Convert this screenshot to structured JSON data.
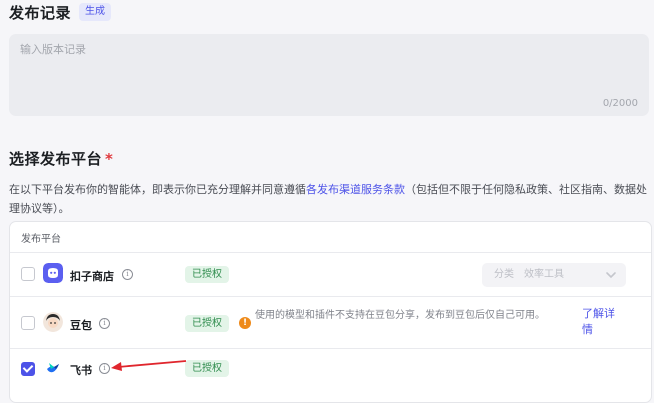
{
  "release_notes": {
    "title": "发布记录",
    "generate_label": "生成",
    "placeholder": "输入版本记录",
    "char_count": "0/2000"
  },
  "platform_section": {
    "title": "选择发布平台",
    "required_mark": "*",
    "description_prefix": "在以下平台发布你的智能体，即表示你已充分理解并同意遵循",
    "description_link": "各发布渠道服务条款",
    "description_suffix": "（包括但不限于任何隐私政策、社区指南、数据处理协议等）。"
  },
  "table": {
    "header": "发布平台",
    "rows": [
      {
        "name": "扣子商店",
        "status": "已授权",
        "checked": false,
        "category_label": "分类",
        "category_value": "效率工具"
      },
      {
        "name": "豆包",
        "status": "已授权",
        "checked": false,
        "warning": "使用的模型和插件不支持在豆包分享，发布到豆包后仅自己可用。",
        "more_link": "了解详情"
      },
      {
        "name": "飞书",
        "status": "已授权",
        "checked": true
      }
    ]
  },
  "colors": {
    "accent": "#4d53e8",
    "authorized_bg": "#e3f4e8",
    "authorized_text": "#2f8c4d",
    "warning": "#ee8a1a",
    "required": "#e0393e",
    "annotation_arrow": "#e0262d"
  },
  "icons": {
    "store": "coze-store-icon",
    "doubao": "doubao-avatar-icon",
    "feishu": "feishu-logo-icon",
    "info": "info-circle-icon",
    "warning": "warning-circle-icon",
    "chevron": "chevron-down-icon"
  }
}
